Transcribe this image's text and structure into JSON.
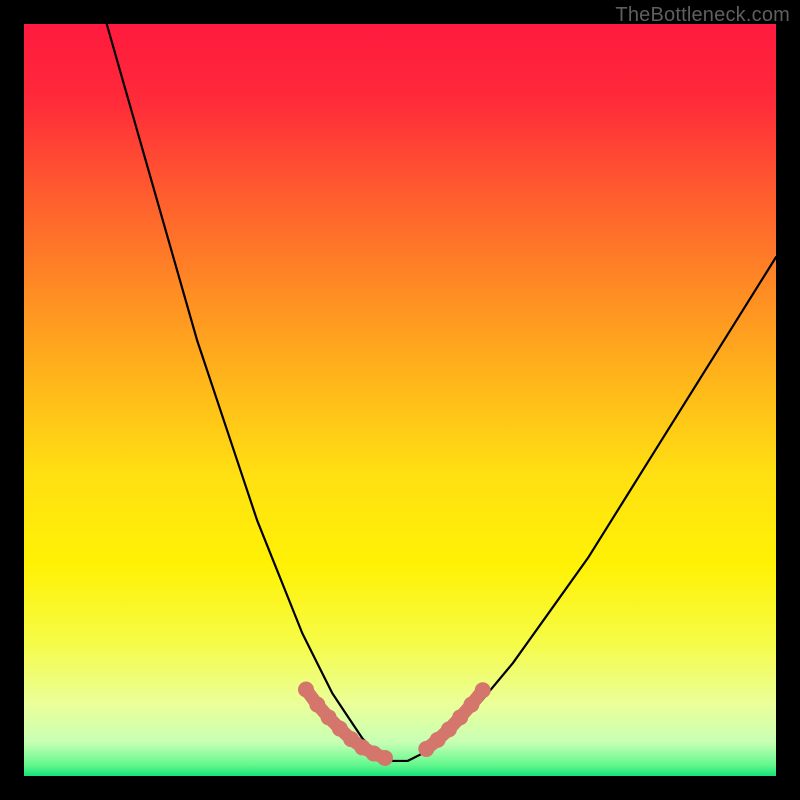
{
  "watermark": "TheBottleneck.com",
  "chart_data": {
    "type": "line",
    "title": "",
    "xlabel": "",
    "ylabel": "",
    "xlim": [
      0,
      100
    ],
    "ylim": [
      0,
      100
    ],
    "grid": false,
    "legend": false,
    "series": [
      {
        "name": "curve",
        "x": [
          11,
          13,
          15,
          17,
          19,
          21,
          23,
          25,
          27,
          29,
          31,
          33,
          35,
          37,
          39,
          41,
          43,
          45,
          47,
          49,
          51,
          53,
          56,
          60,
          65,
          70,
          75,
          80,
          85,
          90,
          95,
          100
        ],
        "values": [
          100,
          93,
          86,
          79,
          72,
          65,
          58,
          52,
          46,
          40,
          34,
          29,
          24,
          19,
          15,
          11,
          8,
          5,
          3,
          2,
          2,
          3,
          5,
          9,
          15,
          22,
          29,
          37,
          45,
          53,
          61,
          69
        ]
      }
    ],
    "highlight_segments": [
      {
        "name": "left-marker-run",
        "x": [
          37.5,
          39,
          40.5,
          42,
          43.5,
          45,
          46.5,
          48
        ],
        "values": [
          11.5,
          9.5,
          7.8,
          6.3,
          4.9,
          3.8,
          3.0,
          2.4
        ]
      },
      {
        "name": "right-marker-run",
        "x": [
          53.5,
          55,
          56.5,
          58,
          59.5,
          61
        ],
        "values": [
          3.6,
          4.8,
          6.2,
          7.8,
          9.5,
          11.4
        ]
      }
    ],
    "gradient_stops": [
      {
        "offset": 0.0,
        "color": "#ff1a3e"
      },
      {
        "offset": 0.1,
        "color": "#ff2a3a"
      },
      {
        "offset": 0.22,
        "color": "#ff5a2f"
      },
      {
        "offset": 0.35,
        "color": "#ff8a24"
      },
      {
        "offset": 0.48,
        "color": "#ffb81a"
      },
      {
        "offset": 0.6,
        "color": "#ffe012"
      },
      {
        "offset": 0.72,
        "color": "#fff205"
      },
      {
        "offset": 0.82,
        "color": "#f6fb45"
      },
      {
        "offset": 0.905,
        "color": "#eaff9a"
      },
      {
        "offset": 0.955,
        "color": "#c8ffb4"
      },
      {
        "offset": 0.985,
        "color": "#64f88e"
      },
      {
        "offset": 1.0,
        "color": "#15e27a"
      }
    ],
    "marker_color": "#d4766b",
    "curve_color": "#000000"
  }
}
